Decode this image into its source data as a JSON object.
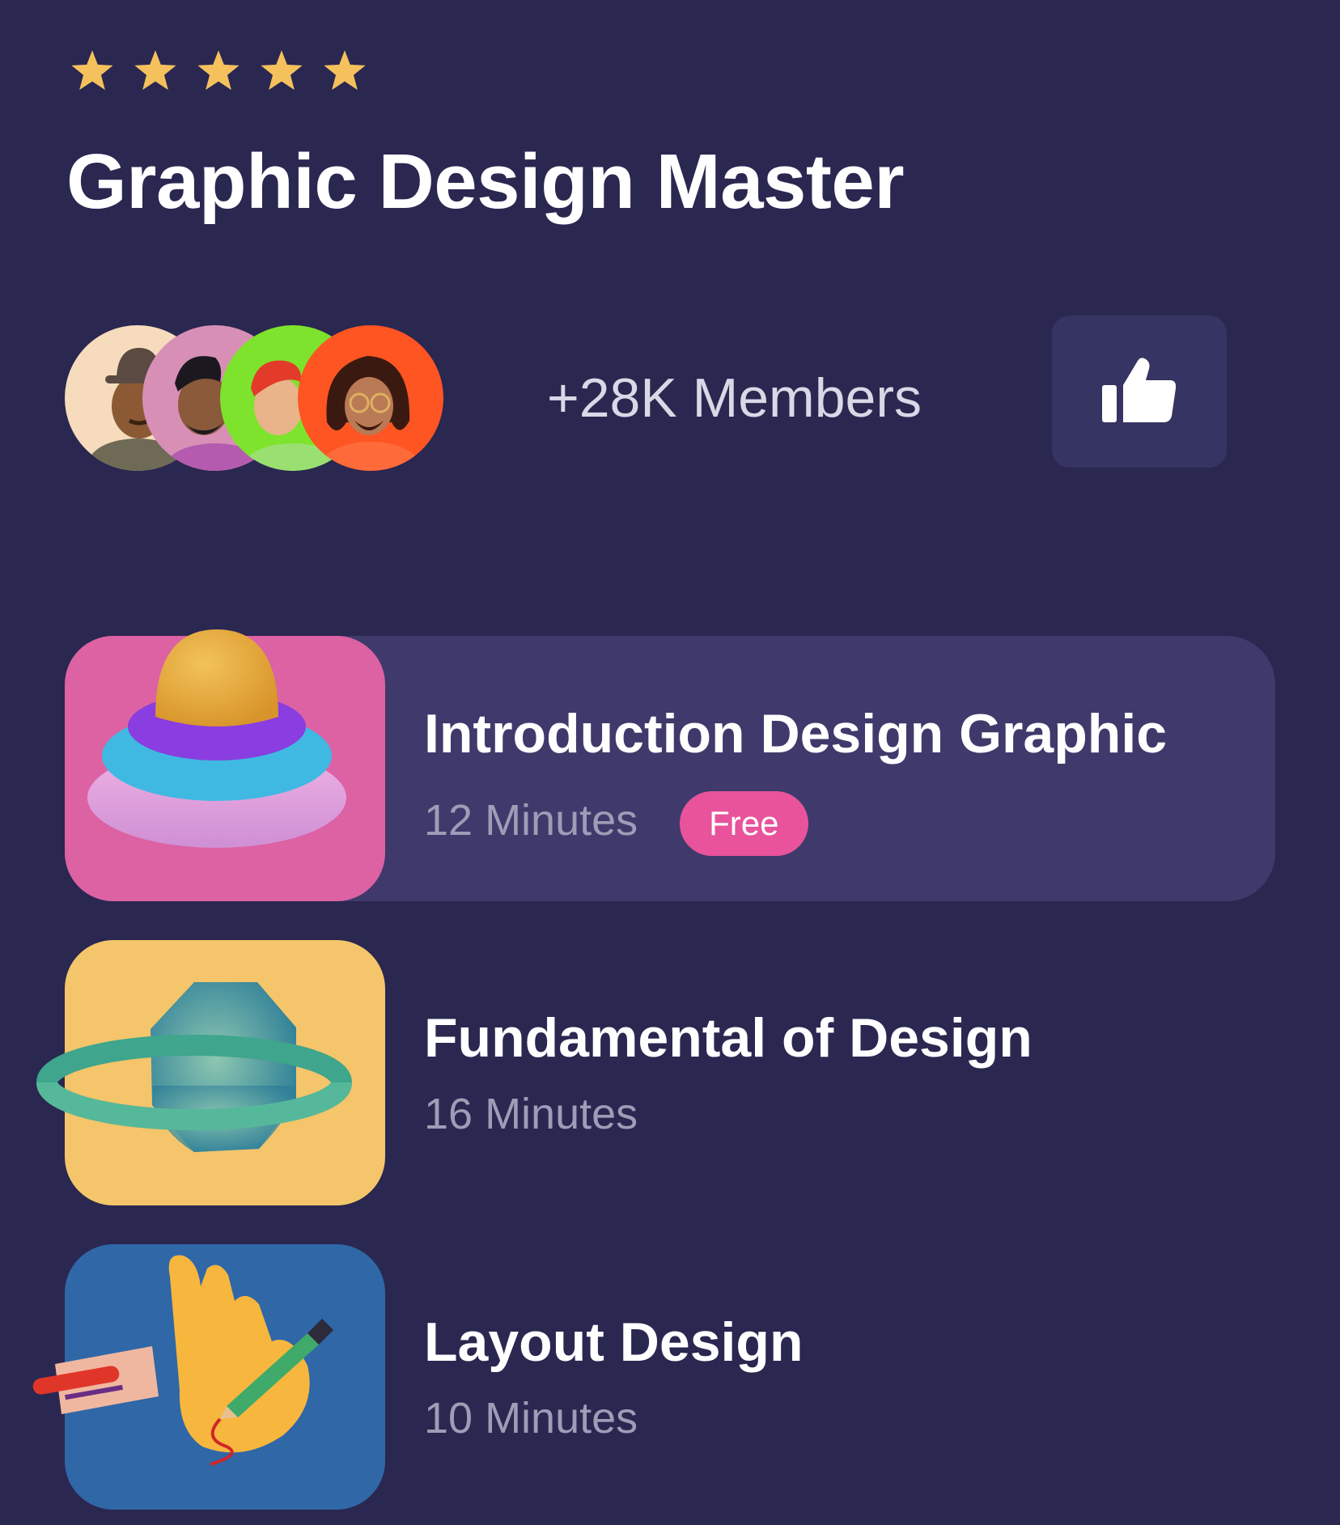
{
  "rating": {
    "stars": 5,
    "max_stars": 5,
    "star_color": "#f4c15d"
  },
  "header": {
    "title": "Graphic Design Master"
  },
  "members": {
    "count_label": "+28K Members",
    "avatars": [
      {
        "icon": "avatar-hat-man",
        "bg": "#f6dcbc"
      },
      {
        "icon": "avatar-bearded-man",
        "bg": "#d88fb6"
      },
      {
        "icon": "avatar-redhead-boy",
        "bg": "#7ee32c"
      },
      {
        "icon": "avatar-curly-hair-man",
        "bg": "#ff5522"
      }
    ]
  },
  "like_button": {
    "icon": "thumbs-up-icon",
    "bg": "#363462"
  },
  "courses": [
    {
      "title": "Introduction Design Graphic",
      "duration": "12 Minutes",
      "badge": "Free",
      "thumb_icon": "stacked-rings-icon",
      "thumb_bg": "#dc62a3",
      "active": true
    },
    {
      "title": "Fundamental of Design",
      "duration": "16 Minutes",
      "thumb_icon": "planet-icon",
      "thumb_bg": "#f4c56a",
      "active": false
    },
    {
      "title": "Layout Design",
      "duration": "10 Minutes",
      "thumb_icon": "hand-pencil-icon",
      "thumb_bg": "#2f67a7",
      "active": false
    }
  ],
  "colors": {
    "background": "#2a2750",
    "active_card": "#3f3a6b",
    "badge": "#e8539c",
    "muted_text": "#9e9cb6"
  }
}
